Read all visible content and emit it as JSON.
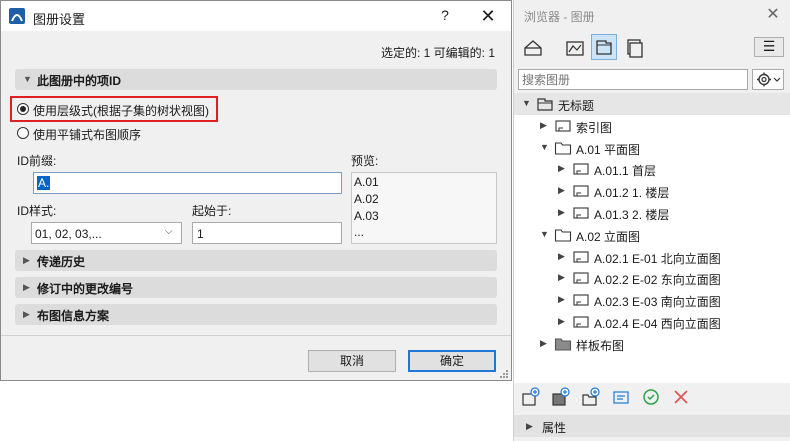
{
  "dialog": {
    "title": "图册设置",
    "help_glyph": "?",
    "close_glyph": "✕",
    "selected_info": "选定的: 1 可编辑的: 1",
    "sections": {
      "id_in_book": "此图册中的项ID",
      "transmittal": "传递历史",
      "revision": "修订中的更改编号",
      "layout_info": "布图信息方案"
    },
    "radio_hierarchical": "使用层级式(根据子集的树状视图)",
    "radio_flat": "使用平铺式布图顺序",
    "id_prefix_label": "ID前缀:",
    "id_prefix_value": "A.",
    "preview_label": "预览:",
    "preview_lines": [
      "A.01",
      "A.02",
      "A.03",
      "..."
    ],
    "id_style_label": "ID样式:",
    "id_style_value": "01, 02, 03,...",
    "start_at_label": "起始于:",
    "start_at_value": "1",
    "cancel": "取消",
    "ok": "确定"
  },
  "browser": {
    "title": "浏览器 - 图册",
    "close_glyph": "✕",
    "search_placeholder": "搜索图册",
    "tree": [
      {
        "label": "无标题",
        "kind": "book",
        "arrow": "▼"
      },
      {
        "label": "索引图",
        "kind": "sheet",
        "arrow": "▶"
      },
      {
        "label": "A.01 平面图",
        "kind": "folder",
        "arrow": "▼"
      },
      {
        "label": "A.01.1 首层",
        "kind": "sheet",
        "arrow": "▶"
      },
      {
        "label": "A.01.2 1. 楼层",
        "kind": "sheet",
        "arrow": "▶"
      },
      {
        "label": "A.01.3 2. 楼层",
        "kind": "sheet",
        "arrow": "▶"
      },
      {
        "label": "A.02 立面图",
        "kind": "folder",
        "arrow": "▼"
      },
      {
        "label": "A.02.1 E-01 北向立面图",
        "kind": "sheet",
        "arrow": "▶"
      },
      {
        "label": "A.02.2 E-02 东向立面图",
        "kind": "sheet",
        "arrow": "▶"
      },
      {
        "label": "A.02.3 E-03 南向立面图",
        "kind": "sheet",
        "arrow": "▶"
      },
      {
        "label": "A.02.4 E-04 西向立面图",
        "kind": "sheet",
        "arrow": "▶"
      },
      {
        "label": "样板布图",
        "kind": "grayfolder",
        "arrow": "▶"
      }
    ],
    "properties": "属性"
  },
  "colors": {
    "accent": "#1e78d7",
    "highlight": "#e02020",
    "green": "#2aa34a",
    "red": "#e05050"
  }
}
